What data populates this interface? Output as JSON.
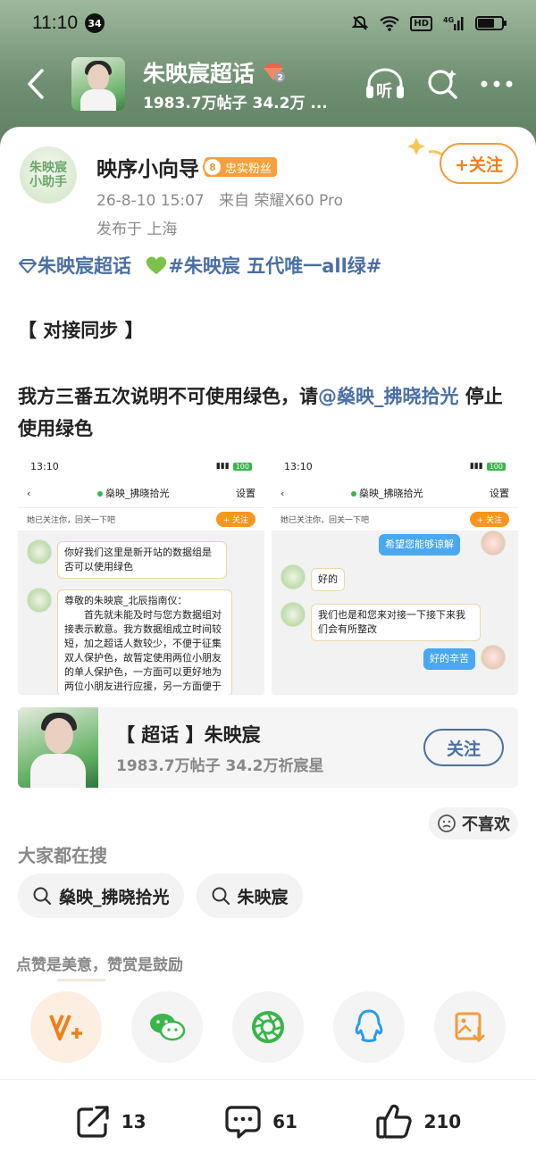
{
  "status": {
    "time": "11:10",
    "notif_count": "34",
    "hd": "HD",
    "signal": "4G"
  },
  "header": {
    "title": "朱映宸超话",
    "level_badge": "2",
    "subtitle": "1983.7万帖子 34.2万 ...",
    "listen_label": "听"
  },
  "post": {
    "avatar_text_1": "朱映宸",
    "avatar_text_2": "小助手",
    "username": "映序小向导",
    "fan_level": "8",
    "fan_label": "忠实粉丝",
    "follow_label": "+关注",
    "timestamp": "26-8-10 15:07",
    "source": "来自 荣耀X60 Pro",
    "location": "发布于 上海",
    "topic_line": {
      "topic1": "朱映宸超话",
      "hashtag": "#朱映宸 五代唯一all绿#"
    },
    "section_title": "【 对接同步 】",
    "body_prefix": "我方三番五次说明不可使用绿色，请",
    "mention": "@燊映_拂晓拾光",
    "body_suffix": " 停止使用绿色"
  },
  "screenshot_left": {
    "time": "13:10",
    "battery": "100",
    "chat_title": "燊映_拂晓拾光",
    "settings": "设置",
    "notice": "她已关注你，回关一下吧",
    "follow": "+ 关注",
    "msg1": "你好我们这里是新开站的数据组是否可以使用绿色",
    "msg2": "尊敬的朱映宸_北辰指南仪：\n　　首先就未能及时与您方数据组对接表示歉意。我方数据组成立时间较短，加之超话人数较少，不便于征集双人保护色，故暂定使用两位小朋友的单人保护色，一方面可以更好地为两位小朋友进行应援，另一方面便于推进日常的各项事"
  },
  "screenshot_right": {
    "time": "13:10",
    "battery": "100",
    "chat_title": "燊映_拂晓拾光",
    "settings": "设置",
    "notice": "她已关注你，回关一下吧",
    "follow": "+ 关注",
    "msg1": "希望您能够谅解",
    "msg2": "好的",
    "msg3": "我们也是和您来对接一下接下来我们会有所整改",
    "msg4": "好的辛苦"
  },
  "topic_card": {
    "title": "【 超话 】朱映宸",
    "subtitle": "1983.7万帖子 34.2万祈宸星",
    "follow": "关注"
  },
  "dislike": "不喜欢",
  "search": {
    "heading": "大家都在搜",
    "chips": [
      "燊映_拂晓拾光",
      "朱映宸"
    ]
  },
  "reward": {
    "heading": "点赞是美意，赞赏是鼓励"
  },
  "share_icons": [
    "vplus-icon",
    "wechat-icon",
    "moments-icon",
    "qq-icon",
    "save-image-icon"
  ],
  "bottom_bar": {
    "repost": "13",
    "comments": "61",
    "likes": "210"
  },
  "colors": {
    "accent_orange": "#f07f1a",
    "link_blue": "#4a6fa5",
    "header_green": "#6f8f72"
  }
}
